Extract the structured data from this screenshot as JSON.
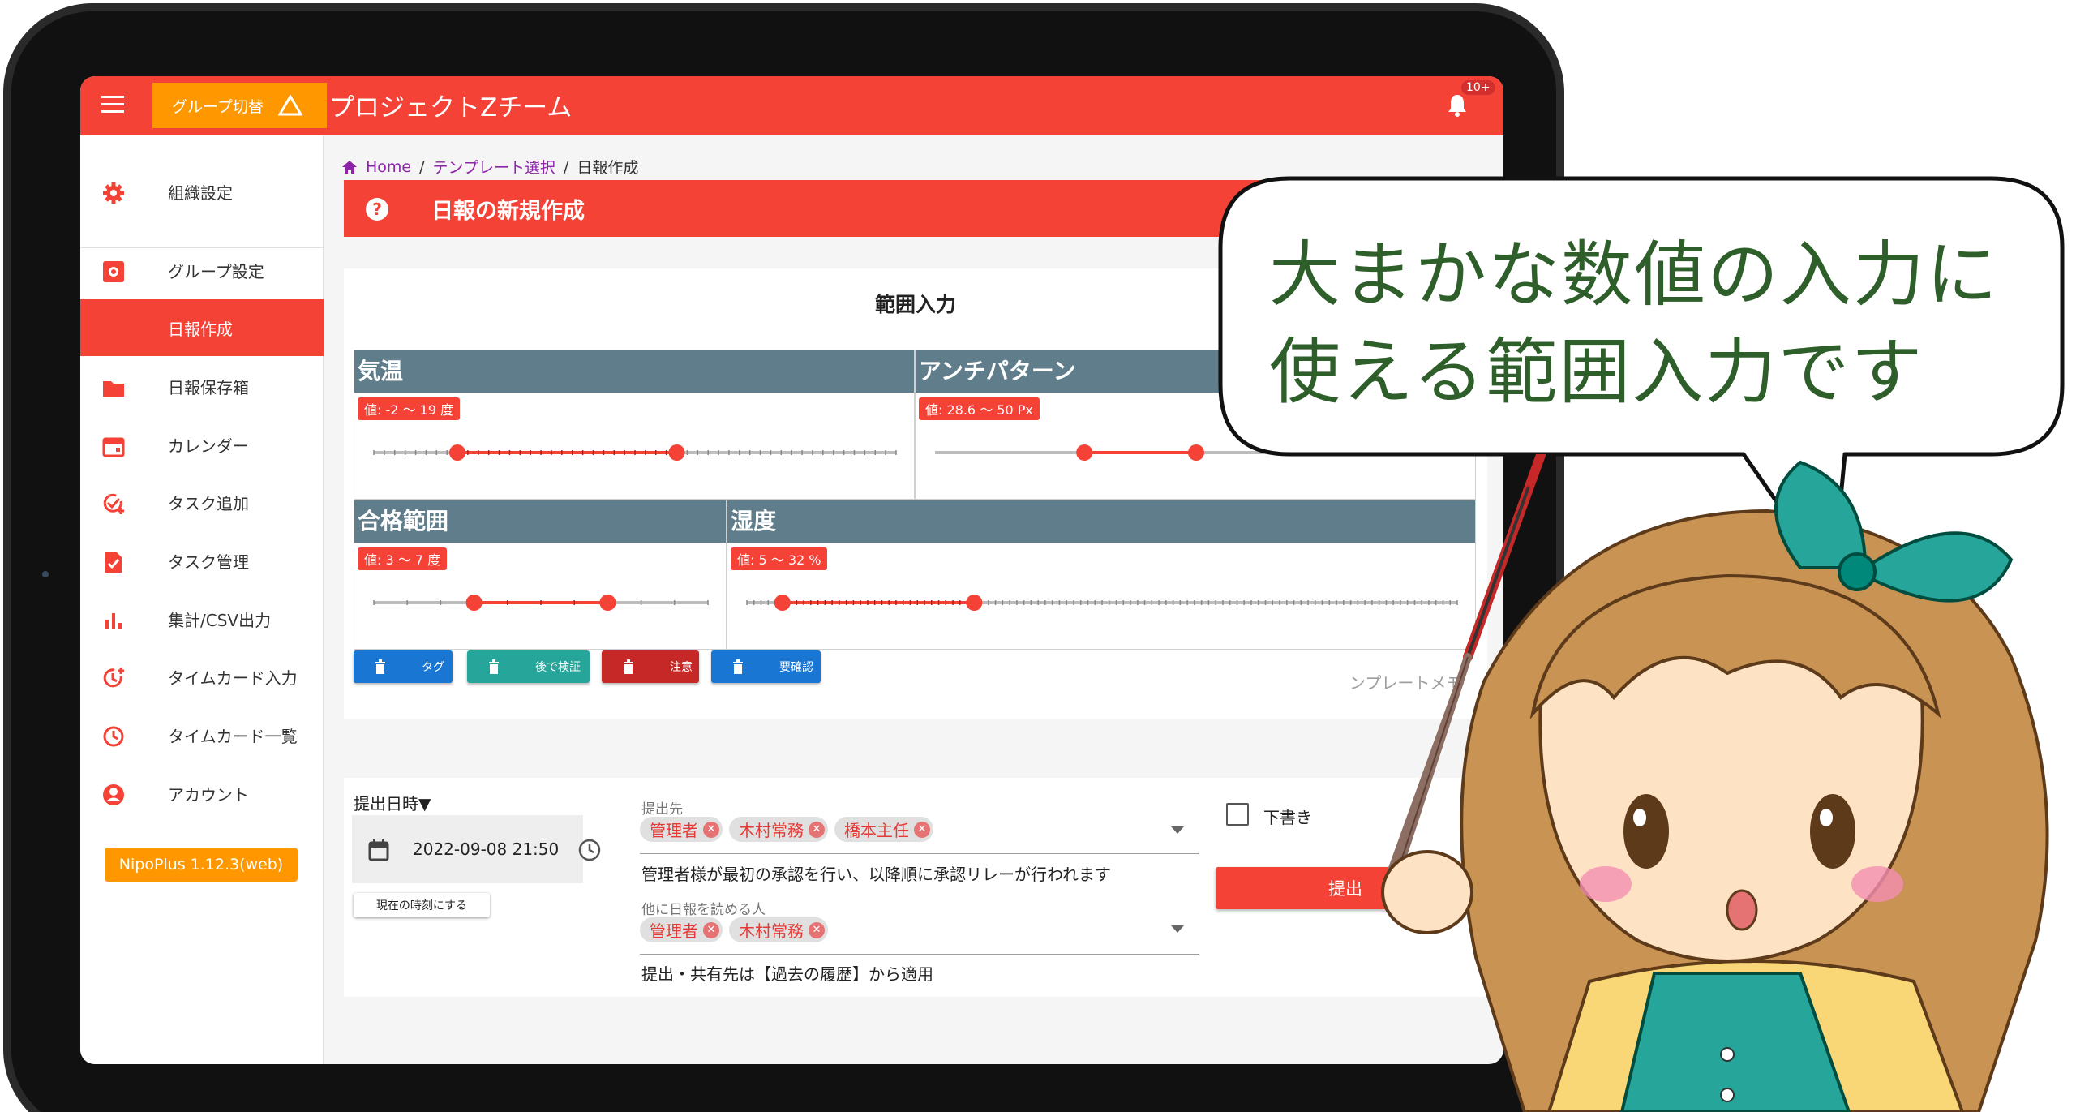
{
  "appbar": {
    "group_switch_label": "グループ切替",
    "title": "プロジェクトZチーム",
    "notification_badge": "10+"
  },
  "sidebar": {
    "items": [
      {
        "label": "組織設定",
        "icon": "gear-icon"
      },
      {
        "label": "グループ設定",
        "icon": "group-settings-icon"
      },
      {
        "label": "日報作成",
        "icon": "edit-icon",
        "active": true
      },
      {
        "label": "日報保存箱",
        "icon": "folder-icon"
      },
      {
        "label": "カレンダー",
        "icon": "calendar-icon"
      },
      {
        "label": "タスク追加",
        "icon": "task-add-icon"
      },
      {
        "label": "タスク管理",
        "icon": "task-check-icon"
      },
      {
        "label": "集計/CSV出力",
        "icon": "bar-chart-icon"
      },
      {
        "label": "タイムカード入力",
        "icon": "clock-add-icon"
      },
      {
        "label": "タイムカード一覧",
        "icon": "clock-icon"
      },
      {
        "label": "アカウント",
        "icon": "account-icon"
      }
    ],
    "version": "NipoPlus 1.12.3(web)"
  },
  "breadcrumb": {
    "home": "Home",
    "template": "テンプレート選択",
    "current": "日報作成"
  },
  "page_title": "日報の新規作成",
  "range_card": {
    "title": "範囲入力",
    "sliders": [
      {
        "name": "気温",
        "value_label": "値: -2 〜 19 度",
        "min": -10,
        "max": 40,
        "low": -2,
        "high": 19,
        "ticks": 50
      },
      {
        "name": "アンチパターン",
        "value_label": "値: 28.6 〜 50 Px",
        "min": 0,
        "max": 100,
        "low": 28.6,
        "high": 50,
        "ticks": 0
      },
      {
        "name": "合格範囲",
        "value_label": "値: 3 〜 7 度",
        "min": 0,
        "max": 10,
        "low": 3,
        "high": 7,
        "ticks": 10
      },
      {
        "name": "湿度",
        "value_label": "値: 5 〜 32 %",
        "min": 0,
        "max": 100,
        "low": 5,
        "high": 32,
        "ticks": 100
      }
    ],
    "tag_buttons": [
      {
        "label": "タグ",
        "color": "#1976d2"
      },
      {
        "label": "後で検証",
        "color": "#26a69a"
      },
      {
        "label": "注意",
        "color": "#c62828"
      },
      {
        "label": "要確認",
        "color": "#1976d2"
      }
    ],
    "memo_hint": "ンプレートメモ"
  },
  "submit_form": {
    "datetime_label": "提出日時▼",
    "datetime_value": "2022-09-08 21:50",
    "now_button": "現在の時刻にする",
    "recipients_label": "提出先",
    "recipients": [
      "管理者",
      "木村常務",
      "橋本主任"
    ],
    "recipients_hint": "管理者様が最初の承認を行い、以降順に承認リレーが行われます",
    "readers_label": "他に日報を読める人",
    "readers": [
      "管理者",
      "木村常務"
    ],
    "readers_hint": "提出・共有先は【過去の履歴】から適用",
    "draft_label": "下書き",
    "submit_label": "提出"
  },
  "speech_bubble": {
    "line1": "大まかな数値の入力に",
    "line2": "使える範囲入力です"
  },
  "colors": {
    "accent": "#f44336",
    "orange": "#ff9800",
    "slate": "#607d8b",
    "chalk_green": "#2e5e2a"
  }
}
